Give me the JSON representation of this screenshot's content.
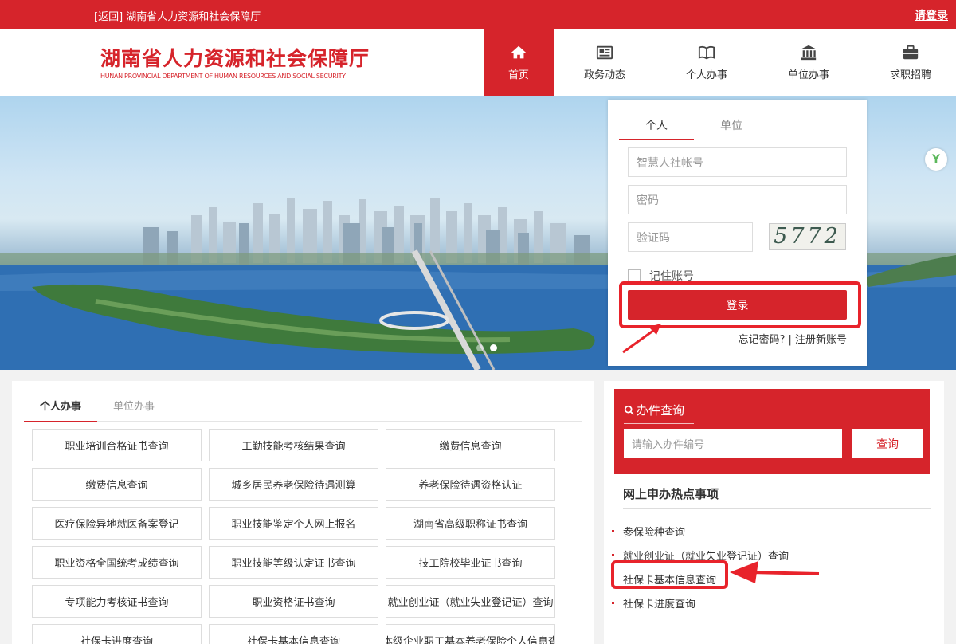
{
  "topbar": {
    "back_label": "[返回]",
    "site_name": "湖南省人力资源和社会保障厅",
    "login_label": "请登录"
  },
  "header": {
    "logo_cn": "湖南省人力资源和社会保障厅",
    "logo_en": "HUNAN PROVINCIAL DEPARTMENT OF HUMAN RESOURCES AND SOCIAL SECURITY",
    "nav": [
      {
        "label": "首页",
        "icon": "home-icon",
        "active": true
      },
      {
        "label": "政务动态",
        "icon": "news-icon"
      },
      {
        "label": "个人办事",
        "icon": "book-icon"
      },
      {
        "label": "单位办事",
        "icon": "building-icon"
      },
      {
        "label": "求职招聘",
        "icon": "briefcase-icon"
      }
    ]
  },
  "login": {
    "tabs": [
      "个人",
      "单位"
    ],
    "account_placeholder": "智慧人社帐号",
    "password_placeholder": "密码",
    "captcha_placeholder": "验证码",
    "captcha_text": "5772",
    "remember_label": "记住账号",
    "submit_label": "登录",
    "forgot_label": "忘记密码?",
    "register_label": "| 注册新账号"
  },
  "services": {
    "tabs": [
      "个人办事",
      "单位办事"
    ],
    "items": [
      "职业培训合格证书查询",
      "工勤技能考核结果查询",
      "缴费信息查询",
      "缴费信息查询",
      "城乡居民养老保险待遇测算",
      "养老保险待遇资格认证",
      "医疗保险异地就医备案登记",
      "职业技能鉴定个人网上报名",
      "湖南省高级职称证书查询",
      "职业资格全国统考成绩查询",
      "职业技能等级认定证书查询",
      "技工院校毕业证书查询",
      "专项能力考核证书查询",
      "职业资格证书查询",
      "就业创业证（就业失业登记证）查询",
      "社保卡进度查询",
      "社保卡基本信息查询",
      "省本级企业职工基本养老保险个人信息查询"
    ]
  },
  "query": {
    "title": "办件查询",
    "placeholder": "请输入办件编号",
    "button": "查询"
  },
  "hot": {
    "title": "网上申办热点事项",
    "items": [
      "参保险种查询",
      "就业创业证（就业失业登记证）查询",
      "社保卡基本信息查询",
      "社保卡进度查询"
    ]
  },
  "colors": {
    "brand_red": "#d6242b",
    "annotation_red": "#e8232b"
  }
}
